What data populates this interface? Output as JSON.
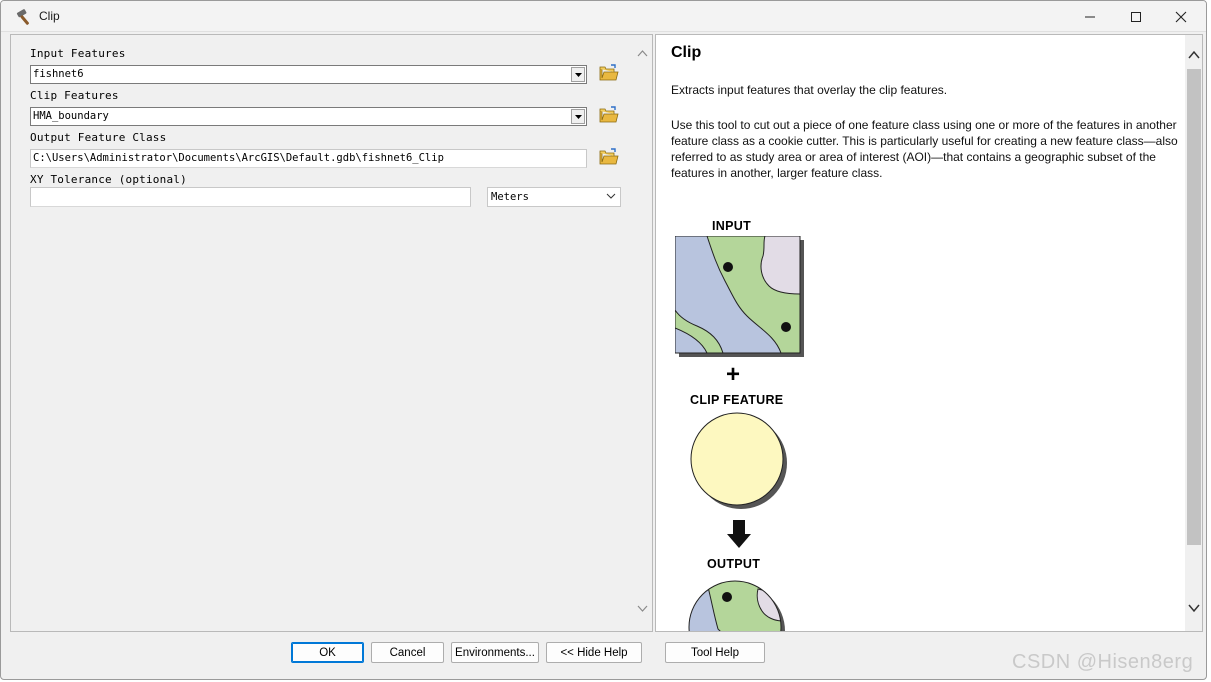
{
  "window": {
    "title": "Clip"
  },
  "parameters": {
    "input_features": {
      "label": "Input Features",
      "value": "fishnet6"
    },
    "clip_features": {
      "label": "Clip Features",
      "value": "HMA_boundary"
    },
    "output_feature_class": {
      "label": "Output Feature Class",
      "value": "C:\\Users\\Administrator\\Documents\\ArcGIS\\Default.gdb\\fishnet6_Clip"
    },
    "xy_tolerance": {
      "label": "XY Tolerance (optional)",
      "value": "",
      "unit": "Meters"
    }
  },
  "help": {
    "title": "Clip",
    "summary": "Extracts input features that overlay the clip features.",
    "description": "Use this tool to cut out a piece of one feature class using one or more of the features in another feature class as a cookie cutter. This is particularly useful for creating a new feature class—also referred to as study area or area of interest (AOI)—that contains a geographic subset of the features in another, larger feature class.",
    "diagram": {
      "input_label": "INPUT",
      "plus": "+",
      "clip_label": "CLIP FEATURE",
      "output_label": "OUTPUT"
    }
  },
  "buttons": {
    "ok": "OK",
    "cancel": "Cancel",
    "environments": "Environments...",
    "hide_help": "<< Hide Help",
    "tool_help": "Tool Help"
  },
  "watermark": "CSDN @Hisen8erg",
  "colors": {
    "water": "#b8c4de",
    "land": "#b4d69a",
    "urban": "#e2dce6",
    "clip_fill": "#fdf8c0",
    "accent": "#0078d7"
  }
}
